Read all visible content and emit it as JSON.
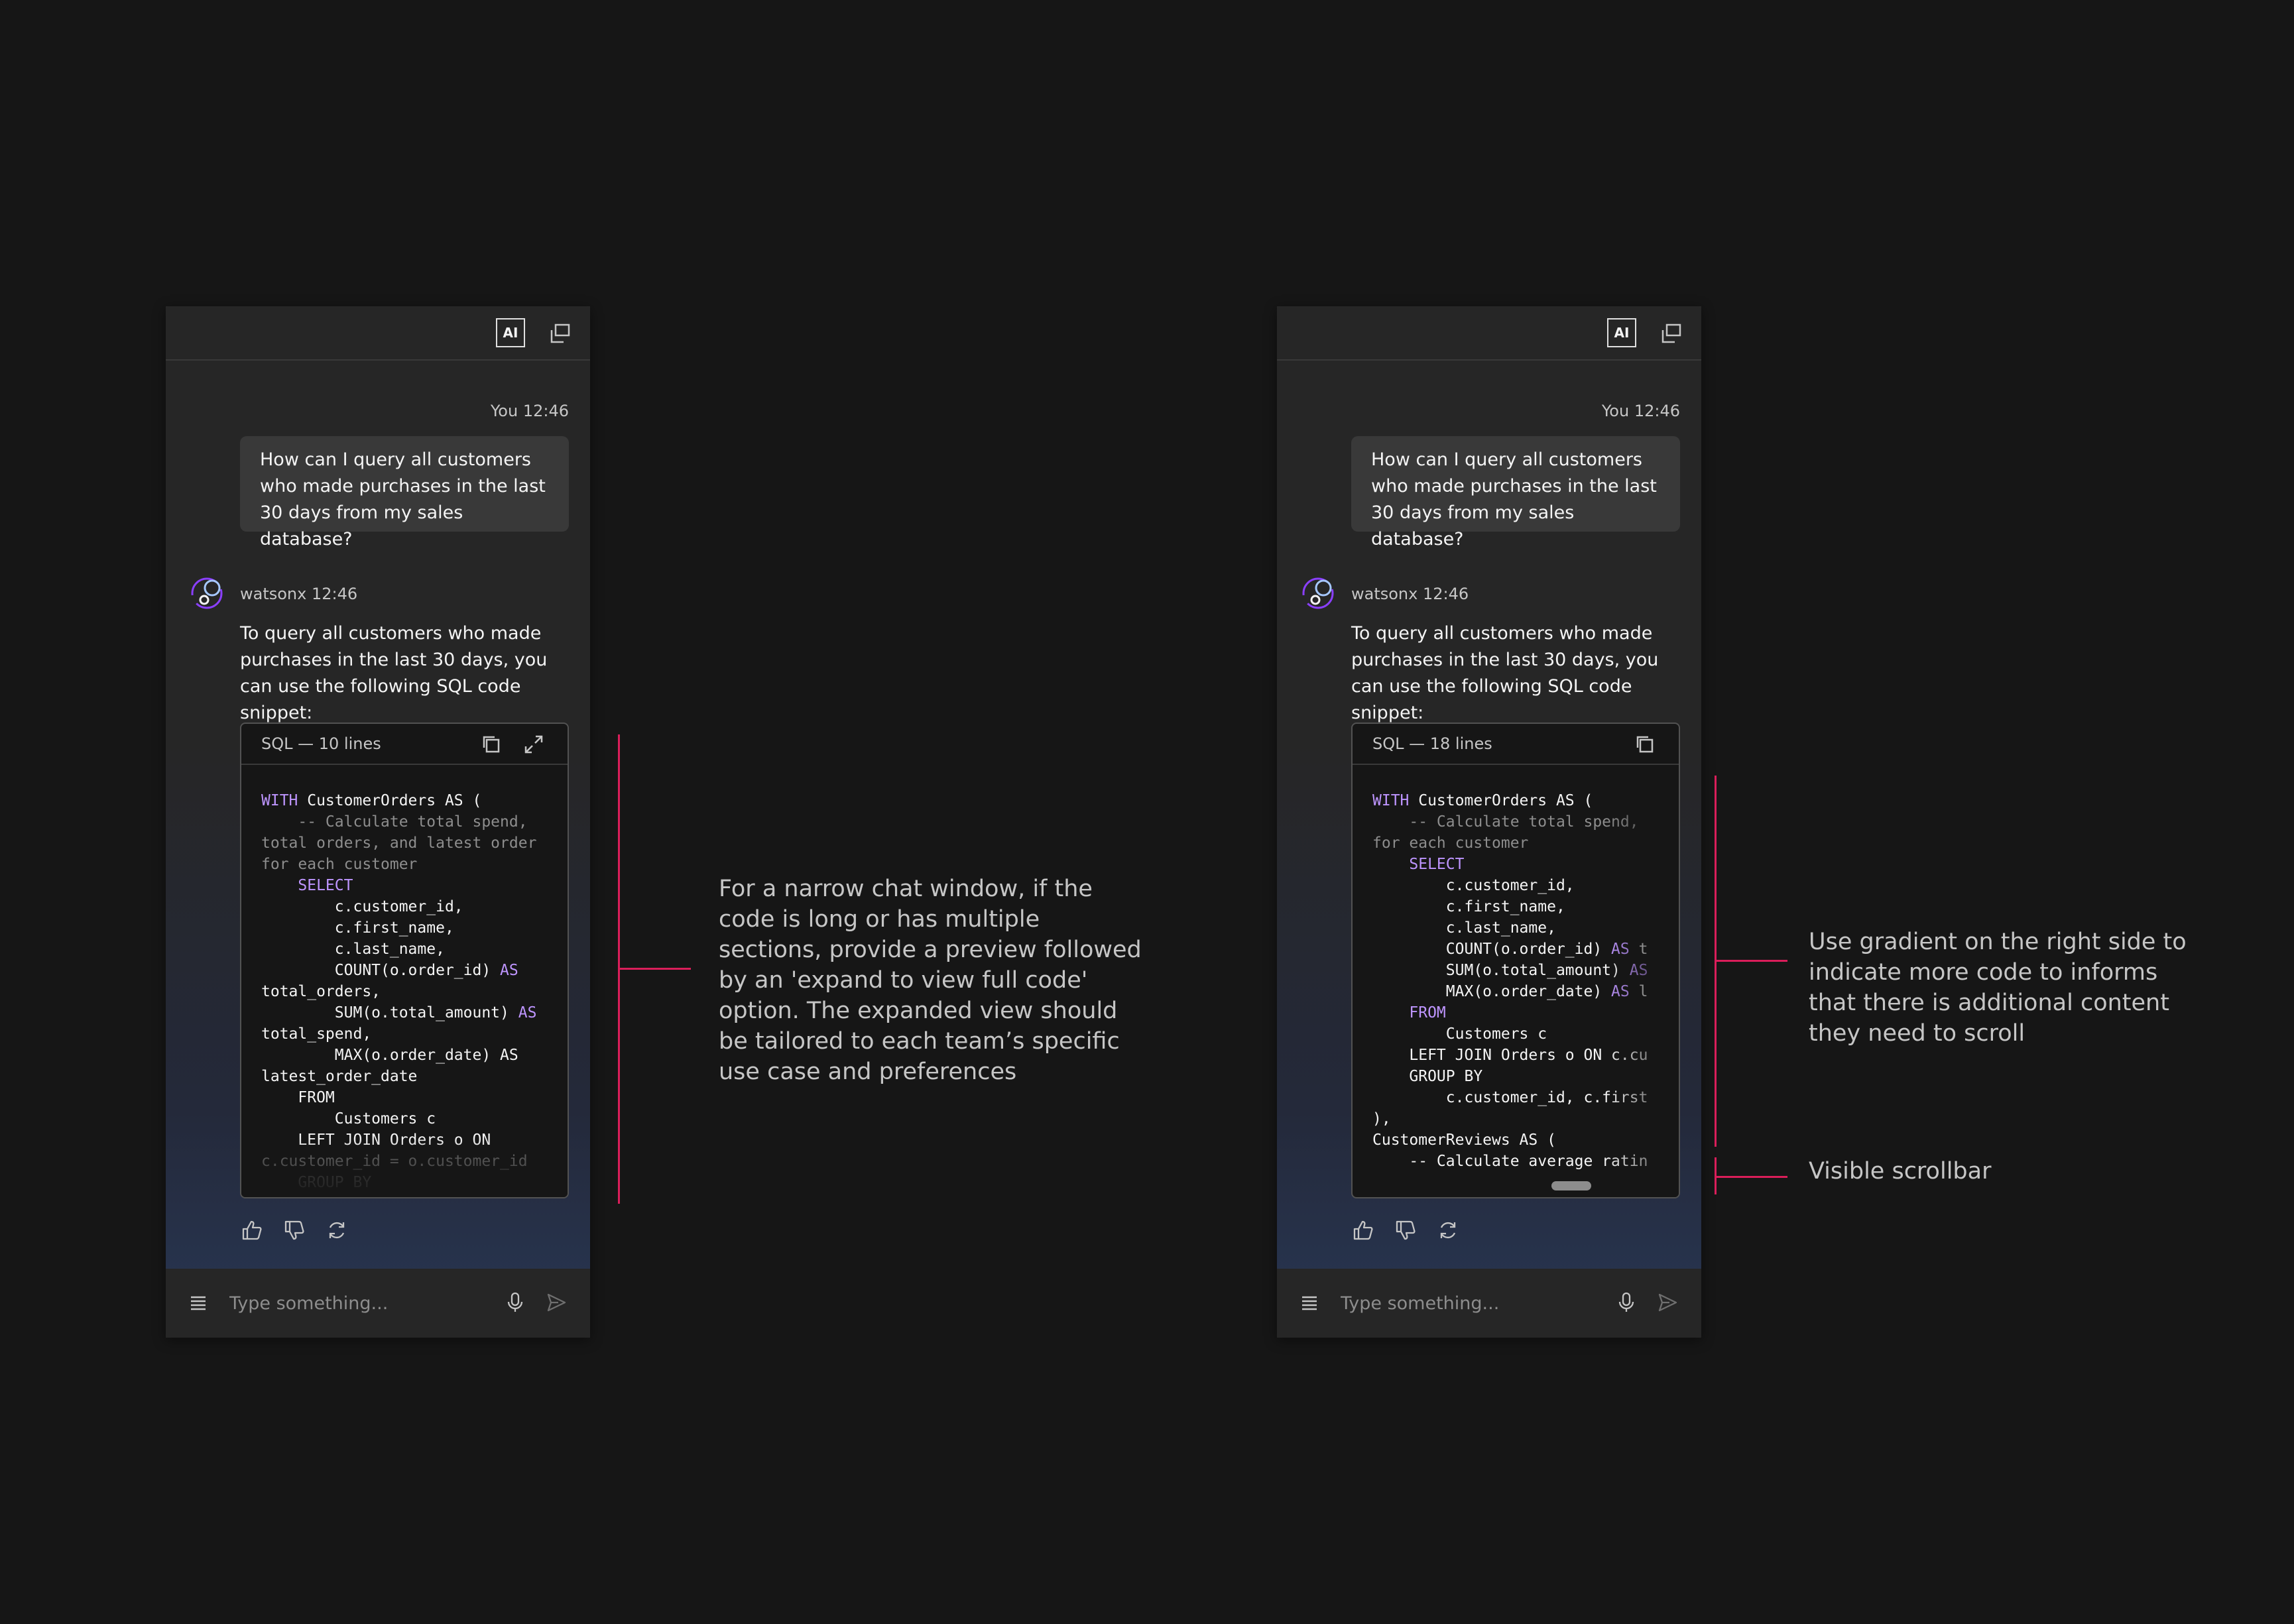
{
  "colors": {
    "background": "#161616",
    "panel": "#262626",
    "keyword": "#be95ff",
    "comment": "#8d8d8d",
    "callout": "#da1e5a"
  },
  "left": {
    "ai_badge": "AI",
    "user_meta": "You 12:46",
    "user_message": "How can I query all customers who made purchases in the last 30 days from my sales database?",
    "bot_meta": "watsonx 12:46",
    "bot_message": "To query all customers who made purchases in the last 30 days, you can use the following SQL code snippet:",
    "code_title": "SQL — 10 lines",
    "input_placeholder": "Type something...",
    "annotation": "For a narrow chat window, if the code is long or has multiple sections, provide a preview followed by an 'expand to view full code' option. The expanded view should be tailored to each team’s specific use case and preferences"
  },
  "right": {
    "ai_badge": "AI",
    "user_meta": "You 12:46",
    "user_message": "How can I query all customers who made purchases in the last 30 days from my sales database?",
    "bot_meta": "watsonx 12:46",
    "bot_message": "To query all customers who made purchases in the last 30 days, you can use the following SQL code snippet:",
    "code_title": "SQL — 18 lines",
    "input_placeholder": "Type something...",
    "annotation_gradient": "Use gradient on the right side to indicate more code to informs that there is additional content they need to scroll",
    "annotation_scrollbar": "Visible scrollbar"
  },
  "icons": {
    "ai": "ai-badge",
    "popout": "popout-icon",
    "avatar": "watsonx-avatar-icon",
    "copy": "copy-icon",
    "expand": "expand-icon",
    "like": "thumbs-up-icon",
    "dislike": "thumbs-down-icon",
    "regenerate": "refresh-icon",
    "menu": "menu-icon",
    "mic": "microphone-icon",
    "send": "send-icon"
  }
}
